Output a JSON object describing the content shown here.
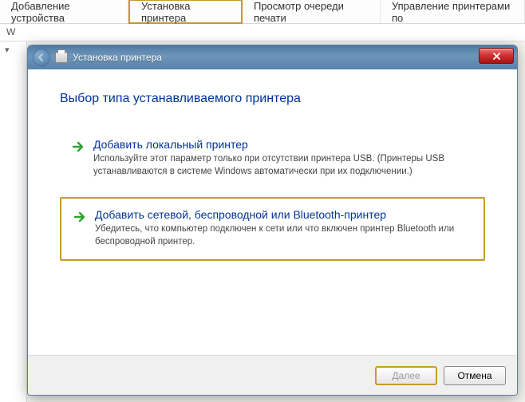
{
  "menu": {
    "items": [
      "Добавление устройства",
      "Установка принтера",
      "Просмотр очереди печати",
      "Управление принтерами по"
    ],
    "highlighted_index": 1
  },
  "secondary": {
    "text": "W"
  },
  "wizard": {
    "title": "Установка принтера",
    "heading": "Выбор типа устанавливаемого принтера",
    "options": [
      {
        "title": "Добавить локальный принтер",
        "desc": "Используйте этот параметр только при отсутствии принтера USB. (Принтеры USB устанавливаются в системе Windows автоматически при их подключении.)"
      },
      {
        "title": "Добавить сетевой, беспроводной или Bluetooth-принтер",
        "desc": "Убедитесь, что компьютер подключен к сети или что включен принтер Bluetooth или беспроводной принтер."
      }
    ],
    "selected_option_index": 1,
    "buttons": {
      "next": "Далее",
      "cancel": "Отмена"
    }
  }
}
